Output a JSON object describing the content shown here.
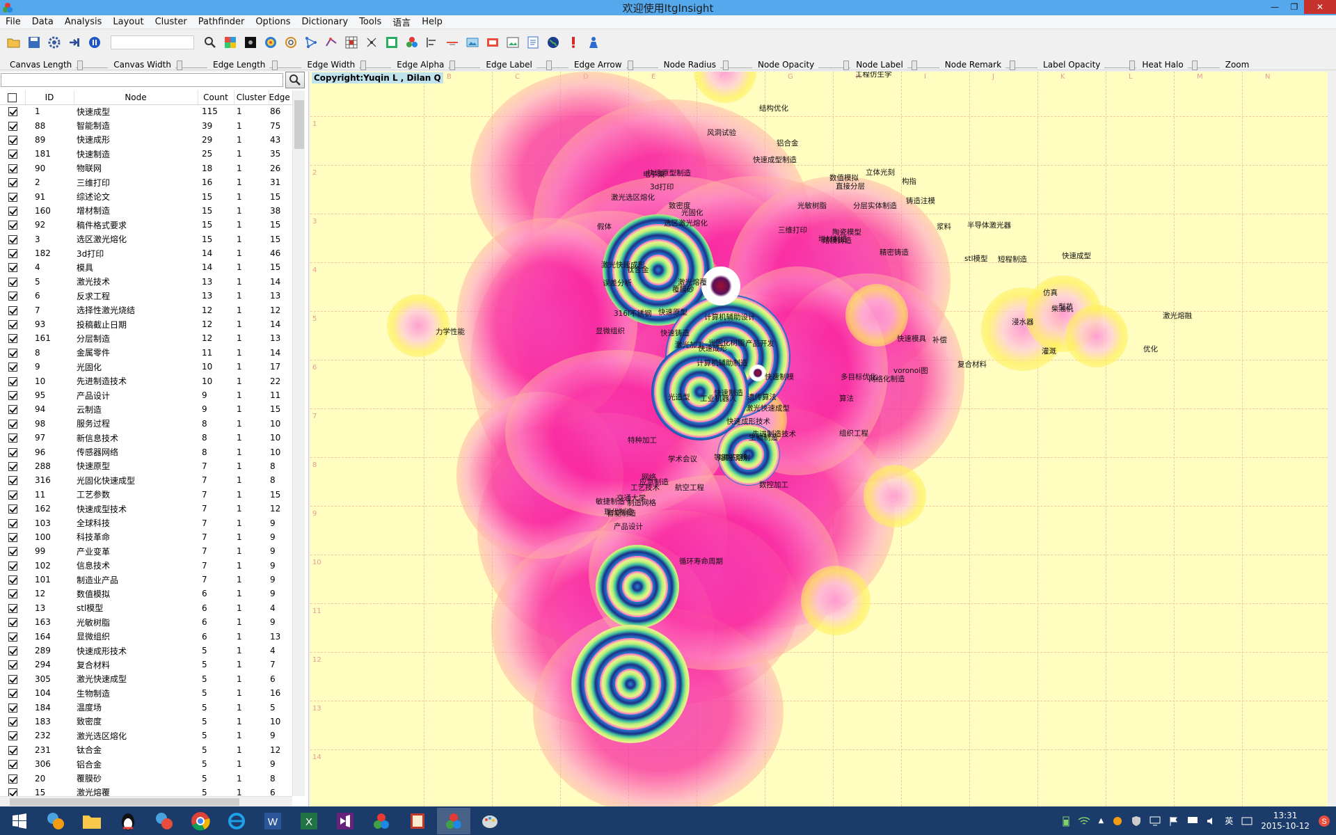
{
  "window": {
    "title": "欢迎使用ItgInsight"
  },
  "menu": [
    "File",
    "Data",
    "Analysis",
    "Layout",
    "Cluster",
    "Pathfinder",
    "Options",
    "Dictionary",
    "Tools",
    "语言",
    "Help"
  ],
  "sliders": [
    "Canvas Length",
    "Canvas Width",
    "Edge Length",
    "Edge Width",
    "Edge Alpha",
    "Edge Label",
    "Edge Arrow",
    "Node Radius",
    "Node Opacity",
    "Node Label",
    "Node Remark",
    "Label Opacity",
    "Heat Halo",
    "Zoom"
  ],
  "table": {
    "headers": [
      "ID",
      "Node",
      "Count",
      "Cluster",
      "Edge"
    ],
    "rows": [
      [
        "1",
        "快速成型",
        "115",
        "1",
        "86"
      ],
      [
        "88",
        "智能制造",
        "39",
        "1",
        "75"
      ],
      [
        "89",
        "快速成形",
        "29",
        "1",
        "43"
      ],
      [
        "181",
        "快速制造",
        "25",
        "1",
        "35"
      ],
      [
        "90",
        "物联网",
        "18",
        "1",
        "26"
      ],
      [
        "2",
        "三维打印",
        "16",
        "1",
        "31"
      ],
      [
        "91",
        "综述论文",
        "15",
        "1",
        "15"
      ],
      [
        "160",
        "增材制造",
        "15",
        "1",
        "38"
      ],
      [
        "92",
        "稿件格式要求",
        "15",
        "1",
        "15"
      ],
      [
        "3",
        "选区激光熔化",
        "15",
        "1",
        "15"
      ],
      [
        "182",
        "3d打印",
        "14",
        "1",
        "46"
      ],
      [
        "4",
        "模具",
        "14",
        "1",
        "15"
      ],
      [
        "5",
        "激光技术",
        "13",
        "1",
        "14"
      ],
      [
        "6",
        "反求工程",
        "13",
        "1",
        "13"
      ],
      [
        "7",
        "选择性激光烧结",
        "12",
        "1",
        "12"
      ],
      [
        "93",
        "投稿截止日期",
        "12",
        "1",
        "14"
      ],
      [
        "161",
        "分层制造",
        "12",
        "1",
        "13"
      ],
      [
        "8",
        "金属零件",
        "11",
        "1",
        "14"
      ],
      [
        "9",
        "光固化",
        "10",
        "1",
        "17"
      ],
      [
        "10",
        "先进制造技术",
        "10",
        "1",
        "22"
      ],
      [
        "95",
        "产品设计",
        "9",
        "1",
        "11"
      ],
      [
        "94",
        "云制造",
        "9",
        "1",
        "15"
      ],
      [
        "98",
        "服务过程",
        "8",
        "1",
        "10"
      ],
      [
        "97",
        "新信息技术",
        "8",
        "1",
        "10"
      ],
      [
        "96",
        "传感器网络",
        "8",
        "1",
        "10"
      ],
      [
        "288",
        "快速原型",
        "7",
        "1",
        "8"
      ],
      [
        "316",
        "光固化快速成型",
        "7",
        "1",
        "8"
      ],
      [
        "11",
        "工艺参数",
        "7",
        "1",
        "15"
      ],
      [
        "162",
        "快速成型技术",
        "7",
        "1",
        "12"
      ],
      [
        "103",
        "全球科技",
        "7",
        "1",
        "9"
      ],
      [
        "100",
        "科技革命",
        "7",
        "1",
        "9"
      ],
      [
        "99",
        "产业变革",
        "7",
        "1",
        "9"
      ],
      [
        "102",
        "信息技术",
        "7",
        "1",
        "9"
      ],
      [
        "101",
        "制造业产品",
        "7",
        "1",
        "9"
      ],
      [
        "12",
        "数值模拟",
        "6",
        "1",
        "9"
      ],
      [
        "13",
        "stl模型",
        "6",
        "1",
        "4"
      ],
      [
        "163",
        "光敏树脂",
        "6",
        "1",
        "9"
      ],
      [
        "164",
        "显微组织",
        "6",
        "1",
        "13"
      ],
      [
        "289",
        "快速成形技术",
        "5",
        "1",
        "4"
      ],
      [
        "294",
        "复合材料",
        "5",
        "1",
        "7"
      ],
      [
        "305",
        "激光快速成型",
        "5",
        "1",
        "6"
      ],
      [
        "104",
        "生物制造",
        "5",
        "1",
        "16"
      ],
      [
        "184",
        "温度场",
        "5",
        "1",
        "5"
      ],
      [
        "183",
        "致密度",
        "5",
        "1",
        "10"
      ],
      [
        "232",
        "激光选区熔化",
        "5",
        "1",
        "9"
      ],
      [
        "231",
        "钛合金",
        "5",
        "1",
        "12"
      ],
      [
        "306",
        "铝合金",
        "5",
        "1",
        "9"
      ],
      [
        "20",
        "覆膜砂",
        "5",
        "1",
        "8"
      ],
      [
        "15",
        "激光熔覆",
        "5",
        "1",
        "6"
      ]
    ]
  },
  "canvas": {
    "copyright": "Copyright:Yuqin L , Dilan Q",
    "col_letters": [
      "B",
      "C",
      "D",
      "E",
      "F",
      "G",
      "H",
      "I",
      "J",
      "K",
      "L",
      "M",
      "N"
    ],
    "row_numbers": [
      "1",
      "2",
      "3",
      "4",
      "5",
      "6",
      "7",
      "8",
      "9",
      "10",
      "11",
      "12",
      "13",
      "14"
    ],
    "labels": [
      "工程仿生学",
      "结构优化",
      "风洞试验",
      "铝合金",
      "快速成型制造",
      "电子束",
      "快速原型制造",
      "立体光刻",
      "数值模拟",
      "直接分层",
      "3d打印",
      "构指",
      "激光选区熔化",
      "致密度",
      "分层实体制造",
      "铸造注模",
      "光敏树脂",
      "光固化",
      "浆料",
      "半导体激光器",
      "假体",
      "选区激光熔化",
      "三维打印",
      "陶瓷模型",
      "增材制造",
      "熔模铸造",
      "精密铸造",
      "stl模型",
      "短程制造",
      "激光快速成形",
      "钛合金",
      "快速成型",
      "激光熔覆",
      "覆膜砂",
      "误差分析",
      "型芯",
      "316l不锈钢",
      "快速原型",
      "计算机辅助设计",
      "仿真",
      "显微组织",
      "快速铸造",
      "快速成形",
      "激光加工",
      "产品开发",
      "光固化树脂",
      "快速模具",
      "补偿",
      "浸水器",
      "柴油机",
      "激光熔融",
      "灌溉",
      "优化",
      "力学性能",
      "计算机辅助制造",
      "复合材料",
      "voronoi图",
      "快速制模",
      "多目标优化",
      "快速制造",
      "算法",
      "遗传算法",
      "光造型",
      "激光快速成型",
      "工业机器人",
      "网络",
      "生物制造",
      "数控加工",
      "快速成形技术",
      "先进制造技术",
      "组织工程",
      "特种加工",
      "网络化制造",
      "学术会议",
      "等离子熔射",
      "熔融沉积",
      "应急制造",
      "制造网格",
      "航空工程",
      "工艺技术",
      "智能制造",
      "敏捷制造",
      "交通大学",
      "现代制造",
      "产品设计",
      "循环寿命周期"
    ]
  },
  "taskbar": {
    "time": "13:31",
    "date": "2015-10-12",
    "ime": "英"
  }
}
